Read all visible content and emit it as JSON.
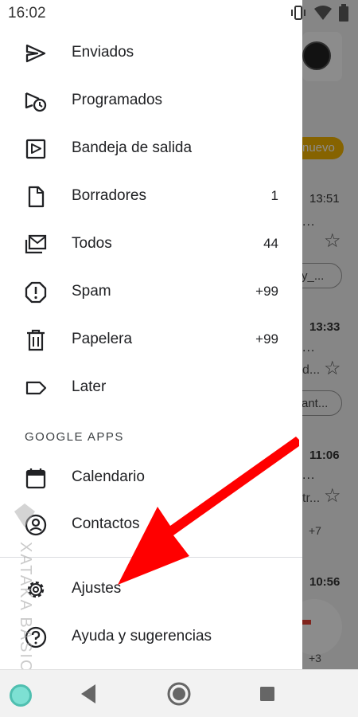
{
  "status_bar": {
    "time": "16:02"
  },
  "drawer": {
    "items": [
      {
        "label": "Enviados",
        "count": "",
        "icon": "send-icon"
      },
      {
        "label": "Programados",
        "count": "",
        "icon": "scheduled-icon"
      },
      {
        "label": "Bandeja de salida",
        "count": "",
        "icon": "outbox-icon"
      },
      {
        "label": "Borradores",
        "count": "1",
        "icon": "draft-icon"
      },
      {
        "label": "Todos",
        "count": "44",
        "icon": "all-mail-icon"
      },
      {
        "label": "Spam",
        "count": "+99",
        "icon": "spam-icon"
      },
      {
        "label": "Papelera",
        "count": "+99",
        "icon": "trash-icon"
      },
      {
        "label": "Later",
        "count": "",
        "icon": "label-icon"
      }
    ],
    "section_header": "GOOGLE APPS",
    "apps": [
      {
        "label": "Calendario",
        "icon": "calendar-icon"
      },
      {
        "label": "Contactos",
        "icon": "contacts-icon"
      }
    ],
    "footer": [
      {
        "label": "Ajustes",
        "icon": "settings-icon"
      },
      {
        "label": "Ayuda y sugerencias",
        "icon": "help-icon"
      }
    ]
  },
  "background_inbox": {
    "badge": "nuevo",
    "times": [
      "13:51",
      "13:33",
      "11:06",
      "10:56"
    ],
    "snippets": [
      "...",
      "y_...",
      "...",
      "d...",
      "ant...",
      "...",
      "tr...",
      "+7",
      "...",
      "+3"
    ]
  },
  "watermark": {
    "text": "XATAKA BASICS"
  },
  "colors": {
    "accent_red": "#ff0000",
    "badge": "#f4b400"
  }
}
